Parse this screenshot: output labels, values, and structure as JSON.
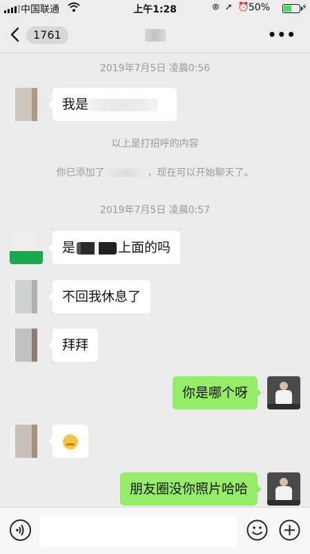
{
  "status_bar": {
    "carrier": "中国联通",
    "time": "上午1:28",
    "battery": "50%"
  },
  "nav": {
    "back_count": "1761",
    "more": "•••"
  },
  "messages": [
    {
      "timestamp": "2019年7月5日 凌晨0:56"
    },
    {
      "text": "我是"
    },
    {
      "system": "以上是打招呼的内容"
    },
    {
      "system_pre": "你已添加了",
      "system_post": "，现在可以开始聊天了。"
    },
    {
      "timestamp": "2019年7月5日 凌晨0:57"
    },
    {
      "text_pre": "是",
      "text_post": "上面的吗"
    },
    {
      "text": "不回我休息了"
    },
    {
      "text": "拜拜"
    },
    {
      "text": "你是哪个呀"
    },
    {
      "emoji": "smirk-emoji"
    },
    {
      "text": "朋友圈没你照片哈哈"
    }
  ],
  "colors": {
    "sent_bubble": "#95ec69",
    "received_bubble": "#ffffff",
    "background": "#ebebeb"
  }
}
